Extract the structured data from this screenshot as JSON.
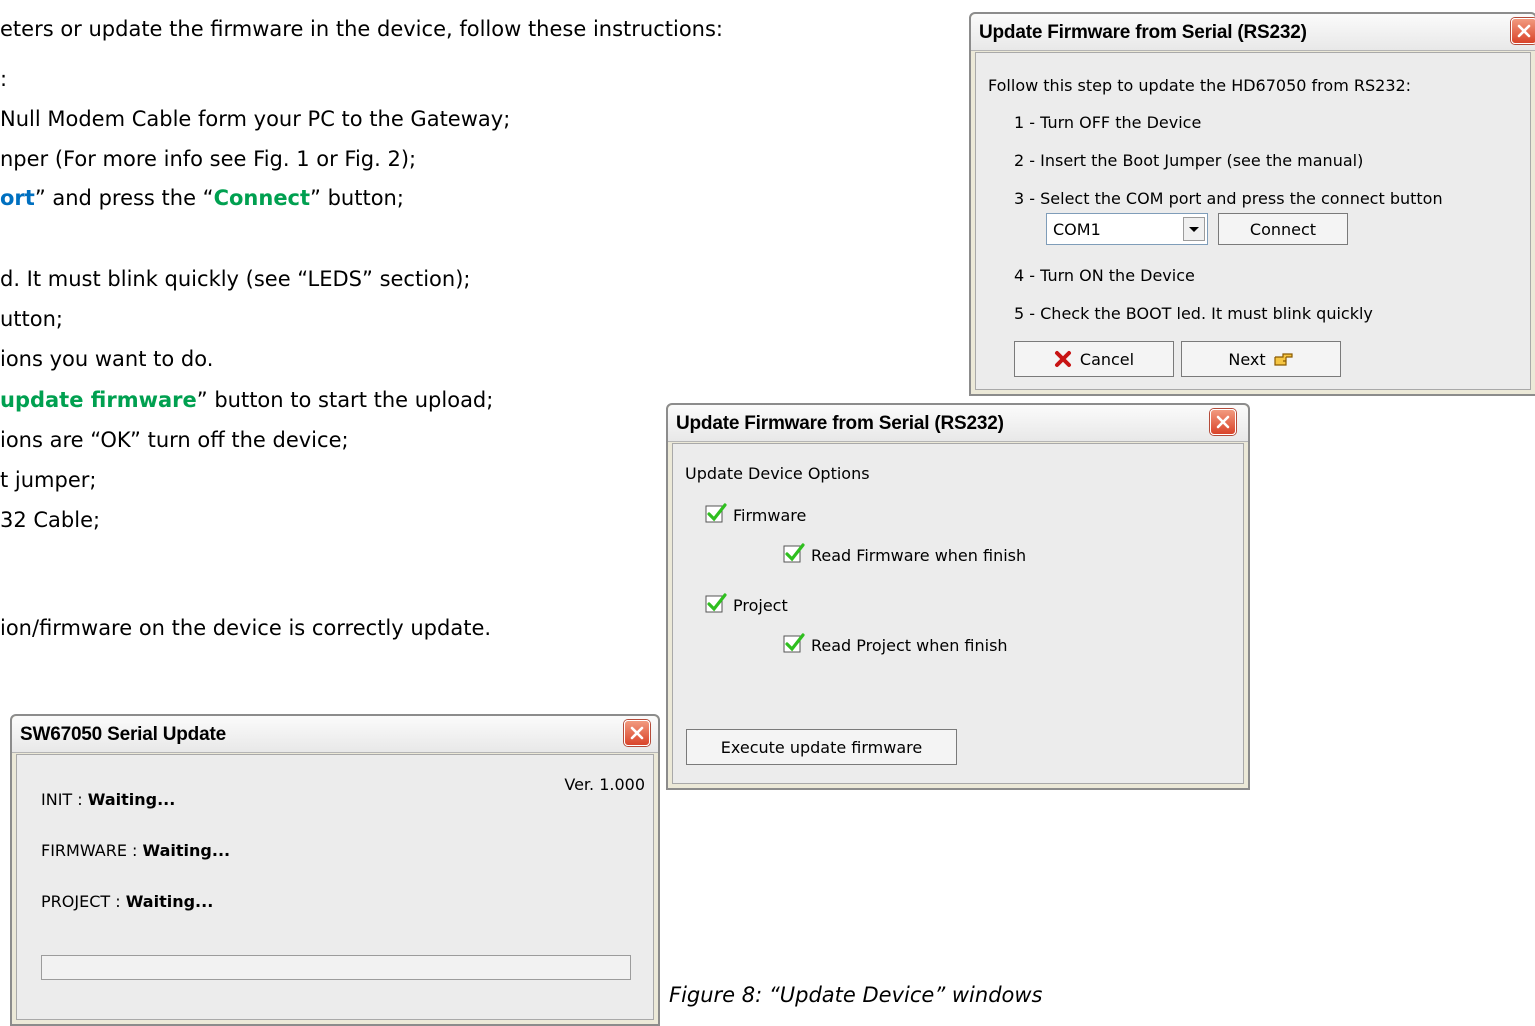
{
  "document": {
    "lines": [
      {
        "before": "eters or update the firmware in the device, follow these instructions:"
      },
      {
        "before": ":"
      },
      {
        "before": " Null Modem Cable form your PC to the Gateway;"
      },
      {
        "before": "nper (For more info see Fig. 1 or Fig. 2);"
      },
      {
        "before": "",
        "hl1": "ort",
        "mid": "” and press the “",
        "hl2": "Connect",
        "after": "” button;"
      },
      {
        "before": "d. It must blink quickly (see “LEDS” section);"
      },
      {
        "before": "utton;"
      },
      {
        "before": "ions you want to do."
      },
      {
        "before": " ",
        "hl2": "update firmware",
        "after": "” button to start the upload;"
      },
      {
        "before": "ions are “OK” turn off the device;"
      },
      {
        "before": "t jumper;"
      },
      {
        "before": "32 Cable;"
      },
      {
        "before": "ion/firmware on the device is correctly update."
      }
    ],
    "caption": "Figure 8: “Update Device” windows"
  },
  "serial_update_window": {
    "title": "SW67050 Serial Update",
    "version": "Ver. 1.000",
    "init_label": "INIT :",
    "init_status": "Waiting...",
    "firmware_label": "FIRMWARE :",
    "firmware_status": "Waiting...",
    "project_label": "PROJECT :",
    "project_status": "Waiting...",
    "progress": 0
  },
  "connect_window": {
    "title": "Update Firmware from Serial (RS232)",
    "intro": "Follow this step to update the HD67050 from RS232:",
    "steps": [
      "1 - Turn OFF the Device",
      "2 - Insert the Boot Jumper (see the manual)",
      "3 - Select the  COM port and press the connect button",
      "4 - Turn ON the Device",
      "5 - Check the BOOT led. It must blink quickly"
    ],
    "com_port": "COM1",
    "connect_label": "Connect",
    "cancel_label": "Cancel",
    "next_label": "Next"
  },
  "options_window": {
    "title": "Update Firmware from Serial (RS232)",
    "heading": "Update Device Options",
    "firmware_label": "Firmware",
    "firmware_checked": true,
    "read_firmware_label": "Read Firmware when finish",
    "read_firmware_checked": true,
    "project_label": "Project",
    "project_checked": true,
    "read_project_label": "Read Project when finish",
    "read_project_checked": true,
    "execute_label": "Execute update firmware"
  },
  "colors": {
    "highlight_blue": "#0070c0",
    "highlight_green": "#00a050",
    "close_red": "#d9442a",
    "check_green": "#2fbf1f"
  }
}
